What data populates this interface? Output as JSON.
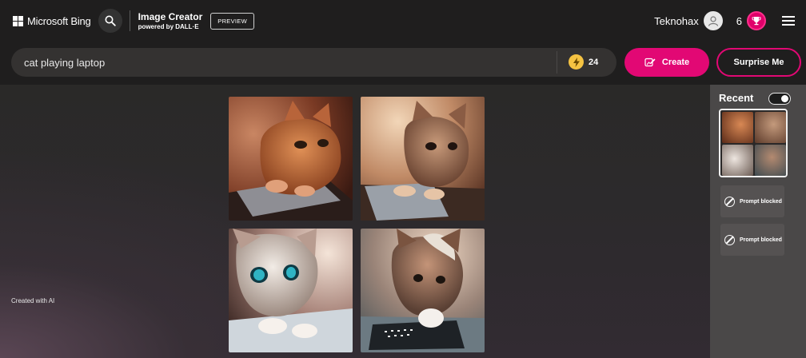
{
  "header": {
    "brand": "Microsoft Bing",
    "app_title": "Image Creator",
    "app_subtitle": "powered by DALL·E",
    "badge": "PREVIEW",
    "username": "Teknohax",
    "rewards_count": "6"
  },
  "toolbar": {
    "prompt_value": "cat playing laptop",
    "boosts": "24",
    "create_label": "Create",
    "surprise_label": "Surprise Me"
  },
  "main": {
    "created_with_ai": "Created with AI",
    "images": [
      {
        "subject": "orange-cat-laptop"
      },
      {
        "subject": "tabby-cat-laptop"
      },
      {
        "subject": "white-cat-blue-eyes-laptop"
      },
      {
        "subject": "calico-cat-laptop"
      }
    ]
  },
  "sidebar": {
    "title": "Recent",
    "toggle_on": true,
    "items": [
      {
        "status": "Prompt blocked"
      },
      {
        "status": "Prompt blocked"
      }
    ]
  },
  "colors": {
    "accent": "#e20874",
    "boost": "#f5c342",
    "header_bg": "#1f1e1e",
    "sidebar_bg": "#4a4848"
  },
  "icons": [
    "windows-logo-icon",
    "search-icon",
    "user-avatar-icon",
    "trophy-icon",
    "menu-icon",
    "bolt-icon",
    "create-icon",
    "blocked-icon"
  ]
}
